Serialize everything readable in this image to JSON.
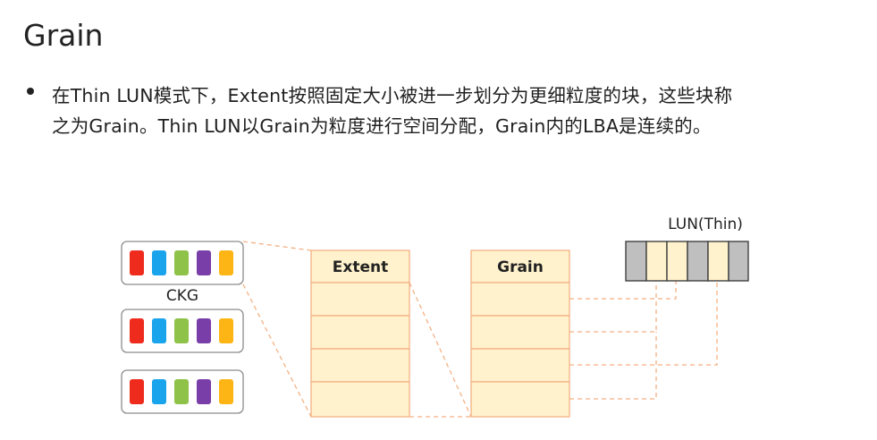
{
  "title": "Grain",
  "description": {
    "line1": "在Thin  LUN模式下，Extent按照固定大小被进一步划分为更细粒度的块，这些块称",
    "line2": "之为Grain。Thin LUN以Grain为粒度进行空间分配，Grain内的LBA是连续的。"
  },
  "diagram": {
    "ckg_label": "CKG",
    "ckg_chunk_colors": [
      "#ef2b1d",
      "#1aa4ec",
      "#8fc249",
      "#7a3ea8",
      "#fdb515"
    ],
    "extent_header": "Extent",
    "grain_header": "Grain",
    "lun_label": "LUN(Thin)",
    "colors": {
      "block_fill": "#fff2cc",
      "block_stroke": "#f4b183",
      "lun_grey": "#bfbfbf",
      "lun_cream": "#fff2cc",
      "connector": "#f4b183"
    }
  }
}
